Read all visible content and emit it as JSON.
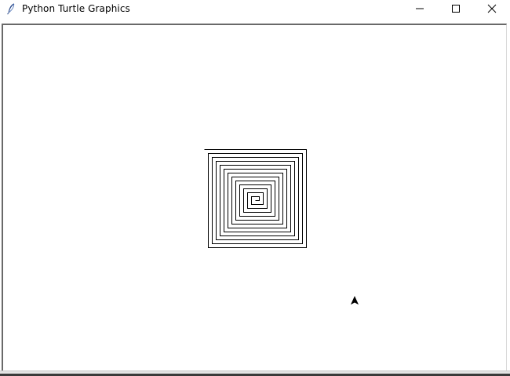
{
  "window": {
    "title": "Python Turtle Graphics",
    "icons": {
      "app": "feather-icon",
      "minimize": "minimize-icon",
      "maximize": "maximize-icon",
      "close": "close-icon"
    }
  },
  "drawing": {
    "shape": "square-spiral",
    "pen_color": "#000000",
    "turtle_shape": "classic-arrow-icon",
    "turtle_heading": "up"
  }
}
